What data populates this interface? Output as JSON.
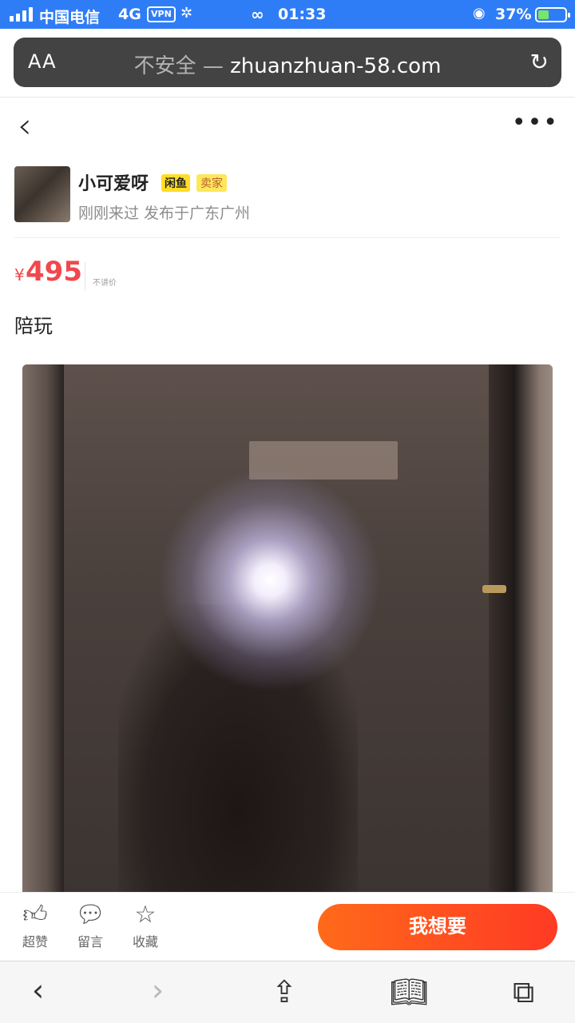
{
  "status_bar": {
    "carrier": "中国电信",
    "network": "4G",
    "vpn": "VPN",
    "time": "01:33",
    "battery": "37%"
  },
  "browser": {
    "text_size_btn": "AA",
    "url_prefix": "不安全 —",
    "url_domain": "zhuanzhuan-58.com"
  },
  "seller": {
    "name": "小可爱呀",
    "badge_xianyu": "闲鱼",
    "badge_role": "卖家",
    "meta": "刚刚来过 发布于广东广州"
  },
  "listing": {
    "currency": "¥",
    "price": "495",
    "bargain_note": "不讲价",
    "title": "陪玩"
  },
  "actions": {
    "like_label": "超赞",
    "comment_label": "留言",
    "favorite_label": "收藏",
    "want_label": "我想要"
  },
  "icons": {
    "back": "chevron-left-icon",
    "more": "more-dots-icon",
    "reload": "reload-icon",
    "like": "thumbs-up-icon",
    "comment": "chat-bubble-icon",
    "favorite": "star-icon",
    "share": "share-icon",
    "bookmarks": "book-icon",
    "tabs": "tabs-icon"
  },
  "colors": {
    "status_bar": "#2f7df6",
    "price": "#f1484d",
    "want_button_start": "#ff6a1a",
    "want_button_end": "#ff3a24",
    "badge_yellow": "#ffdd27"
  }
}
